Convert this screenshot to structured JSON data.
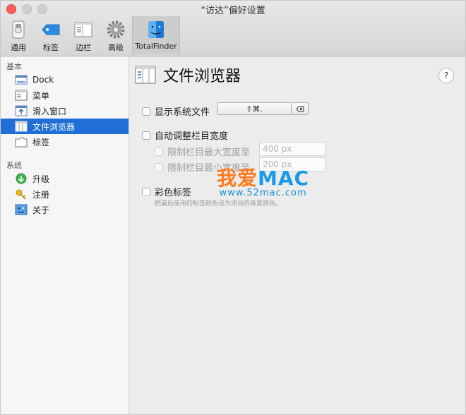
{
  "window": {
    "title": "“访达”偏好设置"
  },
  "toolbar": {
    "items": [
      {
        "label": "通用",
        "icon": "switch-icon"
      },
      {
        "label": "标签",
        "icon": "tag-icon"
      },
      {
        "label": "边栏",
        "icon": "sidebar-icon"
      },
      {
        "label": "高级",
        "icon": "gear-icon"
      },
      {
        "label": "TotalFinder",
        "icon": "finder-icon",
        "selected": true
      }
    ]
  },
  "sidebar": {
    "sections": [
      {
        "title": "基本",
        "items": [
          {
            "label": "Dock",
            "icon": "dock-icon"
          },
          {
            "label": "菜单",
            "icon": "menu-icon"
          },
          {
            "label": "滑入窗口",
            "icon": "slide-window-icon"
          },
          {
            "label": "文件浏览器",
            "icon": "file-browser-icon",
            "selected": true
          },
          {
            "label": "标签",
            "icon": "tab-icon"
          }
        ]
      },
      {
        "title": "系统",
        "items": [
          {
            "label": "升级",
            "icon": "upgrade-icon"
          },
          {
            "label": "注册",
            "icon": "key-icon"
          },
          {
            "label": "关于",
            "icon": "about-icon"
          }
        ]
      }
    ]
  },
  "main": {
    "title": "文件浏览器",
    "help": "?",
    "show_system_files": {
      "label": "显示系统文件",
      "shortcut": "⇧⌘.",
      "checked": false
    },
    "auto_adjust": {
      "label": "自动调整栏目宽度",
      "checked": false
    },
    "max_width": {
      "label": "限制栏目最大宽度至",
      "placeholder": "400 px",
      "enabled": false
    },
    "min_width": {
      "label": "限制栏目最小宽度至",
      "placeholder": "200 px",
      "enabled": false
    },
    "color_tags": {
      "label": "彩色标签",
      "hint": "把最后使用的标签颜色设为项目的背景颜色。",
      "checked": false
    }
  },
  "watermark": {
    "part1": "我爱",
    "part2": "MAC",
    "url": "www.52mac.com"
  },
  "colors": {
    "selection": "#1f6fd6",
    "close": "#fc605b",
    "watermark_orange": "#ff7a1a",
    "watermark_blue": "#1a9be6"
  }
}
